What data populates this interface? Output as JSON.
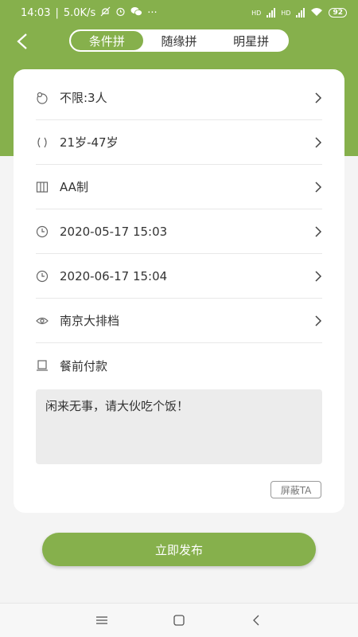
{
  "status": {
    "time": "14:03",
    "speed": "5.0K/s",
    "battery": "92",
    "hd1": "HD",
    "hd2": "HD",
    "more": "···"
  },
  "tabs": [
    {
      "label": "条件拼",
      "active": true
    },
    {
      "label": "随缘拼",
      "active": false
    },
    {
      "label": "明星拼",
      "active": false
    }
  ],
  "form": {
    "people": "不限:3人",
    "age": "21岁-47岁",
    "payment_mode": "AA制",
    "start_time": "2020-05-17 15:03",
    "end_time": "2020-06-17 15:04",
    "location": "南京大排档",
    "pay_timing": "餐前付款",
    "note": "闲来无事，请大伙吃个饭！"
  },
  "block_label": "屏蔽TA",
  "publish_label": "立即发布",
  "colors": {
    "accent": "#86b04c"
  }
}
